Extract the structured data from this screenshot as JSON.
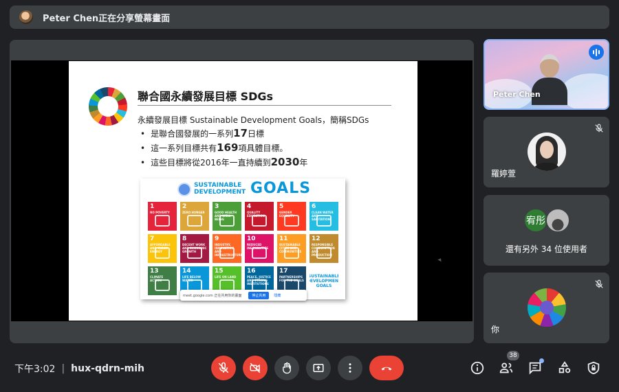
{
  "banner": {
    "text": "Peter Chen正在分享螢幕畫面"
  },
  "slide": {
    "title": "聯合國永續發展目標 SDGs",
    "subtitle": "永續發展目標 Sustainable Development Goals，簡稱SDGs",
    "bullets": [
      {
        "pre": "是聯合國發展的一系列",
        "big": "17",
        "post": "日標"
      },
      {
        "pre": "這一系列目標共有",
        "big": "169",
        "post": "項具體目標。"
      },
      {
        "pre": "這些目標將從2016年一直持續到",
        "big": "2030",
        "post": "年"
      }
    ],
    "poster": {
      "brand_line1": "SUSTAINABLE",
      "brand_line2": "DEVELOPMENT",
      "brand_goals": "GOALS",
      "logo_text": "SUSTAINABLE DEVELOPMENT GOALS",
      "tiles": [
        {
          "num": "1",
          "label": "NO POVERTY",
          "color": "#e5243b"
        },
        {
          "num": "2",
          "label": "ZERO HUNGER",
          "color": "#dda63a"
        },
        {
          "num": "3",
          "label": "GOOD HEALTH AND WELL-BEING",
          "color": "#4c9f38"
        },
        {
          "num": "4",
          "label": "QUALITY EDUCATION",
          "color": "#c5192d"
        },
        {
          "num": "5",
          "label": "GENDER EQUALITY",
          "color": "#ff3a21"
        },
        {
          "num": "6",
          "label": "CLEAN WATER AND SANITATION",
          "color": "#26bde2"
        },
        {
          "num": "7",
          "label": "AFFORDABLE AND CLEAN ENERGY",
          "color": "#fcc30b"
        },
        {
          "num": "8",
          "label": "DECENT WORK AND ECONOMIC GROWTH",
          "color": "#a21942"
        },
        {
          "num": "9",
          "label": "INDUSTRY, INNOVATION AND INFRASTRUCTURE",
          "color": "#fd6925"
        },
        {
          "num": "10",
          "label": "REDUCED INEQUALITIES",
          "color": "#dd1367"
        },
        {
          "num": "11",
          "label": "SUSTAINABLE CITIES AND COMMUNITIES",
          "color": "#fd9d24"
        },
        {
          "num": "12",
          "label": "RESPONSIBLE CONSUMPTION AND PRODUCTION",
          "color": "#bf8b2e"
        },
        {
          "num": "13",
          "label": "CLIMATE ACTION",
          "color": "#3f7e44"
        },
        {
          "num": "14",
          "label": "LIFE BELOW WATER",
          "color": "#0a97d9"
        },
        {
          "num": "15",
          "label": "LIFE ON LAND",
          "color": "#56c02b"
        },
        {
          "num": "16",
          "label": "PEACE, JUSTICE AND STRONG INSTITUTIONS",
          "color": "#00689d"
        },
        {
          "num": "17",
          "label": "PARTNERSHIPS FOR THE GOALS",
          "color": "#19486a"
        }
      ]
    },
    "share_pill": {
      "text": "meet.google.com 正在共用你的畫面",
      "stop_label": "停止共用",
      "hide_label": "隱藏"
    }
  },
  "participants": {
    "speaker": {
      "name": "Peter Chen"
    },
    "p2": {
      "name": "羅婷萱"
    },
    "p3": {
      "initials": "宥彤",
      "others_text": "還有另外 34 位使用者"
    },
    "self": {
      "name": "你"
    }
  },
  "bottom": {
    "time": "下午3:02",
    "separator": "|",
    "meeting_code": "hux-qdrn-mih",
    "people_count": "38"
  },
  "colors": {
    "accent": "#8ab4f8",
    "danger": "#ea4335",
    "surface": "#3c4043",
    "background": "#202124"
  }
}
